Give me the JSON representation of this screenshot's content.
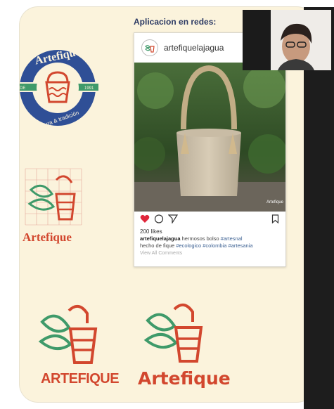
{
  "slide": {
    "section_title": "Aplicacion en redes:",
    "seal": {
      "brand": "Artefique",
      "left_band": "DE",
      "right_band": "1991",
      "tagline": "Cultura & tradición"
    },
    "logos": {
      "grid_word": "Artefique",
      "bold_word": "ARTEFIQUE",
      "rounded_word": "Artefique"
    }
  },
  "instagram_post": {
    "username": "artefiquelajagua",
    "likes": "200 likes",
    "caption_user": "artefiquelajagua",
    "caption_text": "hermosos bolso",
    "hashtags_line1": "#artesnal",
    "caption_line2_text": "hecho de fique",
    "hashtags_line2": "#ecologico #colombia #artesania",
    "view_comments": "View All Comments",
    "photo_watermark": "Artefique"
  },
  "colors": {
    "slide_bg": "#fbf3dc",
    "brand_red": "#d2472e",
    "brand_green": "#3f9a6a",
    "seal_blue": "#2f4f96",
    "title_navy": "#2c3a64",
    "heart_red": "#e0263b"
  },
  "icons": [
    "heart-icon",
    "comment-icon",
    "send-icon",
    "bookmark-icon",
    "logo-icon"
  ]
}
